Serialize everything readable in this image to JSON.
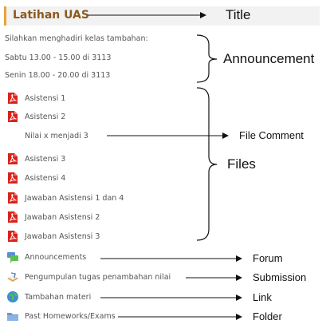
{
  "section_title": "Latihan UAS",
  "announcement_lines": [
    "Silahkan menghadiri kelas tambahan:",
    "Sabtu 13.00 - 15.00 di 3113",
    "Senin 18.00 - 20.00 di 3113"
  ],
  "files": {
    "group_a": [
      "Asistensi 1",
      "Asistensi 2"
    ],
    "file_comment": "Nilai x menjadi 3",
    "group_b": [
      "Asistensi 3",
      "Asistensi 4",
      "Jawaban Asistensi 1 dan 4",
      "Jawaban Asistensi 2",
      "Jawaban Asistensi 3"
    ]
  },
  "modules": [
    {
      "label": "Announcements",
      "icon": "forum-icon"
    },
    {
      "label": "Pengumpulan tugas penambahan nilai",
      "icon": "submission-icon"
    },
    {
      "label": "Tambahan materi",
      "icon": "link-globe-icon"
    },
    {
      "label": "Past Homeworks/Exams",
      "icon": "folder-icon"
    }
  ],
  "annotations": {
    "title": "Title",
    "announcement": "Announcement",
    "file_comment": "File Comment",
    "files": "Files",
    "forum": "Forum",
    "submission": "Submission",
    "link": "Link",
    "folder": "Folder"
  },
  "colors": {
    "title_accent": "#e8a33a",
    "title_text": "#8a5a1e",
    "pdf_red": "#d9241c"
  }
}
